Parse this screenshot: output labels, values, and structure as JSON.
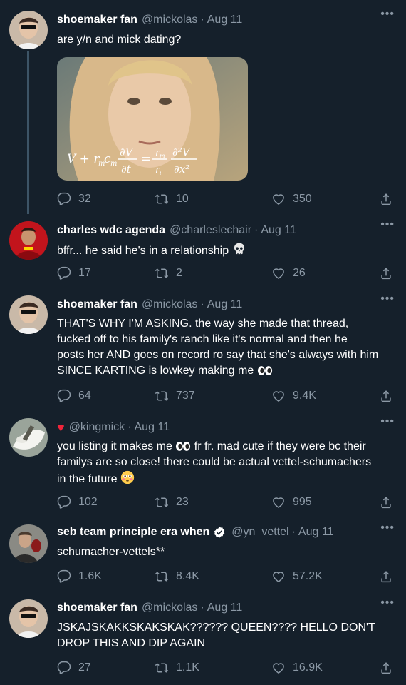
{
  "colors": {
    "background": "#15202b",
    "secondary_text": "#8b98a5",
    "thread_line": "#3d5466",
    "heart_red": "#f0243a"
  },
  "tweets": [
    {
      "name": "shoemaker fan",
      "handle": "@mickolas",
      "date": "Aug 11",
      "text": "are y/n and mick dating?",
      "media_overlay": "V + r m c m ∂V/∂t = r m/r i ∂²V/∂x²",
      "replies": "32",
      "retweets": "10",
      "likes": "350"
    },
    {
      "name": "charles wdc agenda",
      "handle": "@charleslechair",
      "date": "Aug 11",
      "text": "bffr... he said he's in a relationship",
      "replies": "17",
      "retweets": "2",
      "likes": "26"
    },
    {
      "name": "shoemaker fan",
      "handle": "@mickolas",
      "date": "Aug 11",
      "text_lines": [
        "THAT'S WHY I'M ASKING.  the way she made that thread,",
        "fucked off to his family's ranch like it's normal and then he",
        "posts her AND goes on record ro say that she's always with him",
        "SINCE KARTING is lowkey making me"
      ],
      "replies": "64",
      "retweets": "737",
      "likes": "9.4K"
    },
    {
      "name": "",
      "handle": "@kingmick",
      "date": "Aug 11",
      "text_lines": [
        "you listing it makes me",
        "fr fr. mad cute if they were bc their",
        "familys are so close! there could be actual vettel-schumachers",
        "in the future"
      ],
      "replies": "102",
      "retweets": "23",
      "likes": "995"
    },
    {
      "name": "seb team principle era when",
      "handle": "@yn_vettel",
      "date": "Aug 11",
      "text": "schumacher-vettels**",
      "replies": "1.6K",
      "retweets": "8.4K",
      "likes": "57.2K"
    },
    {
      "name": "shoemaker fan",
      "handle": "@mickolas",
      "date": "Aug 11",
      "text_lines": [
        "JSKAJSKAKKSKAKSKAK?????? QUEEN???? HELLO DON'T",
        "DROP THIS AND DIP AGAIN"
      ],
      "replies": "27",
      "retweets": "1.1K",
      "likes": "16.9K"
    }
  ],
  "more_label": "•••",
  "dot": "·"
}
